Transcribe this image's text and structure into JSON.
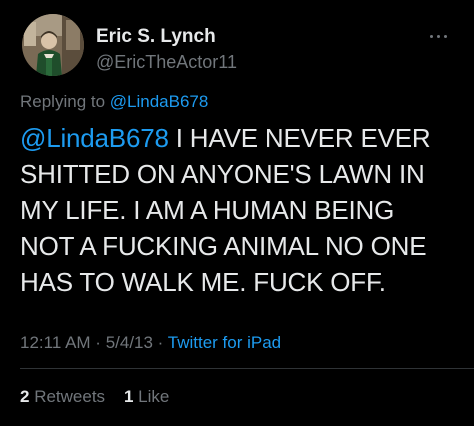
{
  "author": {
    "display_name": "Eric S. Lynch",
    "handle": "@EricTheActor11"
  },
  "reply": {
    "prefix": "Replying to ",
    "to": "@LindaB678"
  },
  "tweet": {
    "mention": "@LindaB678",
    "lines": [
      " I HAVE NEVER EVER",
      "SHITTED ON ANYONE'S LAWN IN",
      "MY LIFE. I AM A HUMAN BEING",
      "NOT A FUCKING ANIMAL NO ONE",
      "HAS TO WALK ME. FUCK OFF."
    ]
  },
  "meta": {
    "time": "12:11 AM",
    "sep1": " · ",
    "date": "5/4/13",
    "sep2": " · ",
    "source": "Twitter for iPad"
  },
  "stats": {
    "retweets_count": "2",
    "retweets_label": " Retweets",
    "likes_count": "1",
    "likes_label": " Like"
  },
  "icons": {
    "more": "more-horizontal-icon"
  },
  "colors": {
    "background": "#000000",
    "text_primary": "#e7e9ea",
    "text_secondary": "#71767b",
    "accent": "#1d9bf0",
    "divider": "#2f3336"
  }
}
